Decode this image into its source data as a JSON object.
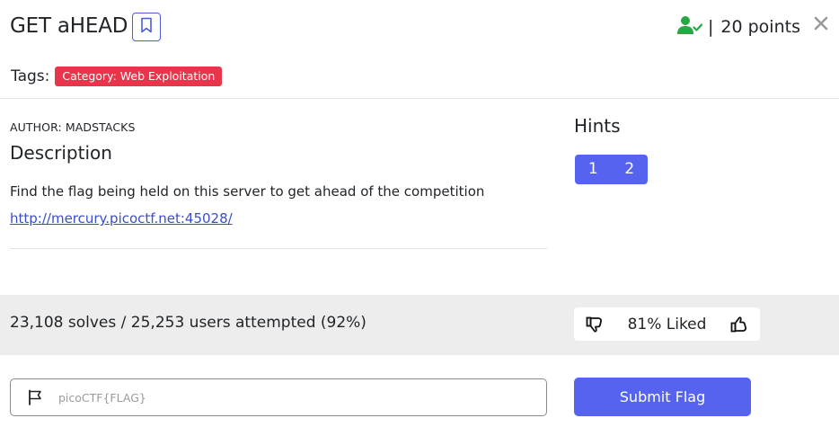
{
  "header": {
    "title": "GET aHEAD",
    "points_separator": "|",
    "points": "20 points"
  },
  "tags": {
    "label": "Tags:",
    "items": [
      "Category: Web Exploitation"
    ]
  },
  "description": {
    "author": "AUTHOR: MADSTACKS",
    "heading": "Description",
    "text": "Find the flag being held on this server to get ahead of the competition",
    "link": "http://mercury.picoctf.net:45028/"
  },
  "hints": {
    "heading": "Hints",
    "items": [
      "1",
      "2"
    ]
  },
  "stats": {
    "solves_text": "23,108 solves / 25,253 users attempted (92%)",
    "liked_text": "81% Liked"
  },
  "flag_form": {
    "placeholder": "picoCTF{FLAG}",
    "submit_label": "Submit Flag"
  },
  "colors": {
    "accent": "#5563ee",
    "tag_red": "#e8354b",
    "solved_green": "#28a745",
    "stats_bg": "#ededed"
  },
  "icons": {
    "bookmark": "bookmark-icon",
    "solved": "user-check-icon",
    "close": "close-icon",
    "thumbs_down": "thumbs-down-icon",
    "thumbs_up": "thumbs-up-icon",
    "flag": "flag-icon"
  }
}
